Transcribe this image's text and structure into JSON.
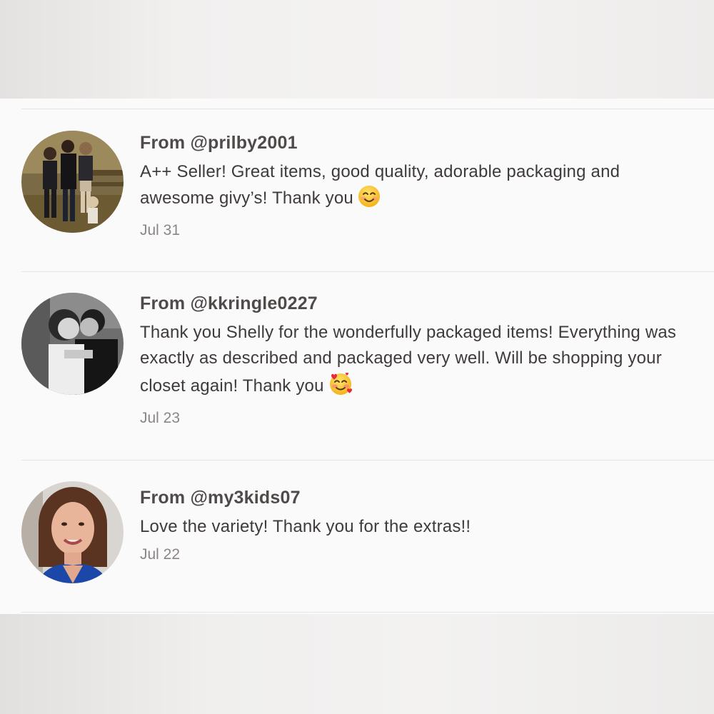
{
  "reviews": [
    {
      "from": "From @prilby2001",
      "text": "A++ Seller! Great items, good quality, adorable packaging and awesome givy’s! Thank you",
      "emoji": "smiling-face-icon",
      "date": "Jul 31"
    },
    {
      "from": "From @kkringle0227",
      "text": "Thank you Shelly for the wonderfully packaged items! Everything was exactly as described and packaged very well. Will be shopping your closet again! Thank you",
      "emoji": "smiling-face-with-hearts-icon",
      "date": "Jul 23"
    },
    {
      "from": "From @my3kids07",
      "text": "Love the variety! Thank you for the extras!!",
      "date": "Jul 22"
    }
  ]
}
